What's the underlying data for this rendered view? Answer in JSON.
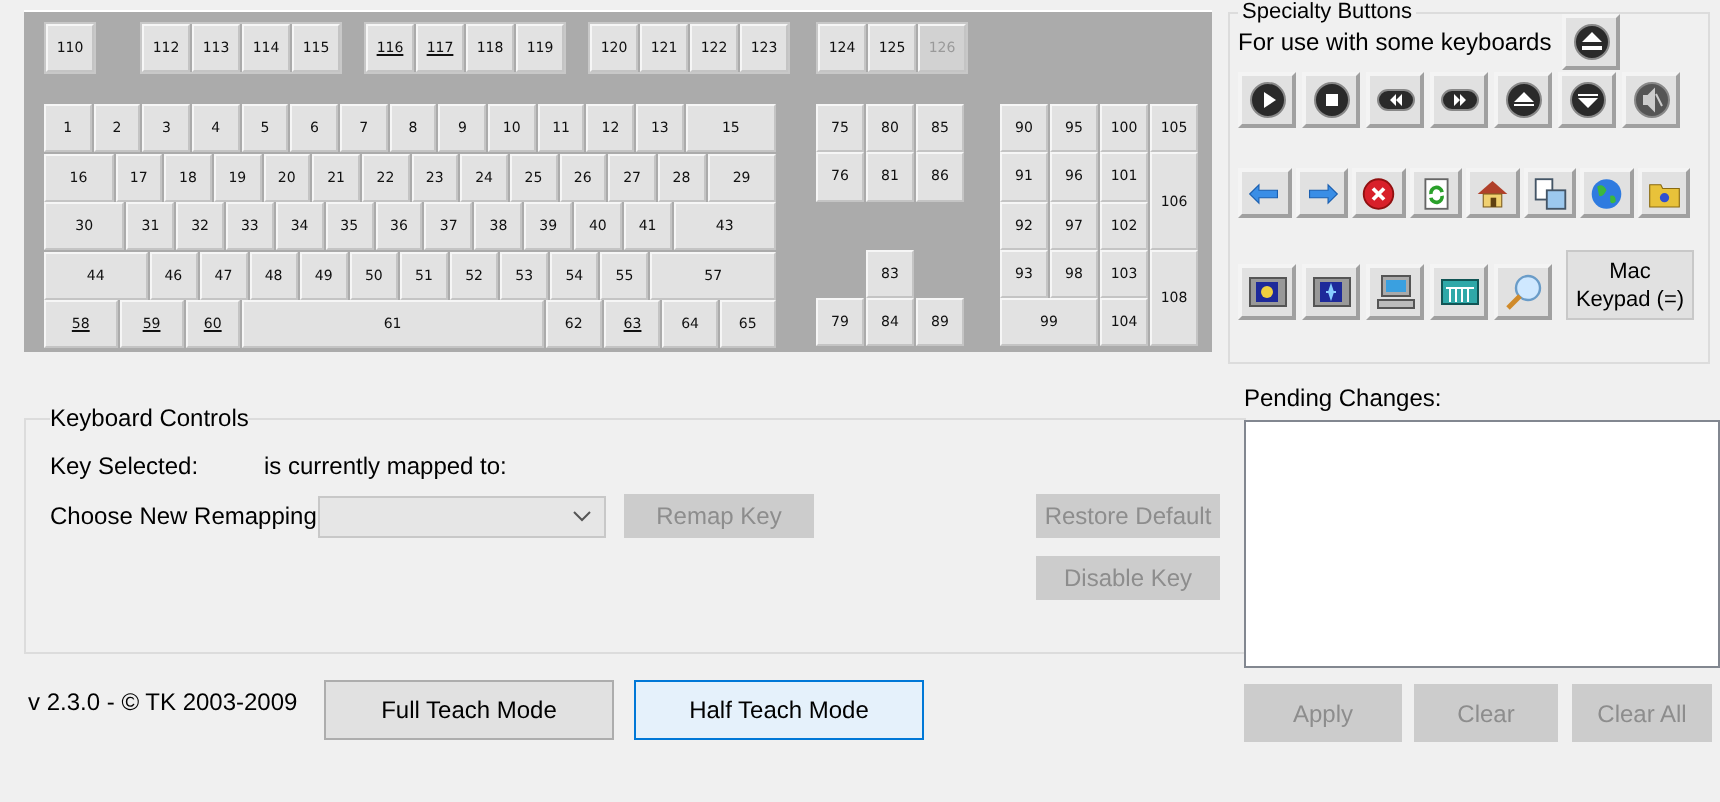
{
  "keyboard": {
    "function_groups": [
      [
        {
          "label": "110",
          "underlined": false
        }
      ],
      [
        {
          "label": "112",
          "underlined": false
        },
        {
          "label": "113",
          "underlined": false
        },
        {
          "label": "114",
          "underlined": false
        },
        {
          "label": "115",
          "underlined": false
        }
      ],
      [
        {
          "label": "116",
          "underlined": true
        },
        {
          "label": "117",
          "underlined": true
        },
        {
          "label": "118",
          "underlined": false
        },
        {
          "label": "119",
          "underlined": false
        }
      ],
      [
        {
          "label": "120",
          "underlined": false
        },
        {
          "label": "121",
          "underlined": false
        },
        {
          "label": "122",
          "underlined": false
        },
        {
          "label": "123",
          "underlined": false
        }
      ]
    ],
    "main_rows": [
      [
        {
          "label": "1",
          "underlined": false
        },
        {
          "label": "2",
          "underlined": false
        },
        {
          "label": "3",
          "underlined": false
        },
        {
          "label": "4",
          "underlined": false
        },
        {
          "label": "5",
          "underlined": false
        },
        {
          "label": "6",
          "underlined": false
        },
        {
          "label": "7",
          "underlined": false
        },
        {
          "label": "8",
          "underlined": false
        },
        {
          "label": "9",
          "underlined": false
        },
        {
          "label": "10",
          "underlined": false
        },
        {
          "label": "11",
          "underlined": false
        },
        {
          "label": "12",
          "underlined": false
        },
        {
          "label": "13",
          "underlined": false
        },
        {
          "label": "15",
          "underlined": false
        }
      ],
      [
        {
          "label": "16",
          "underlined": false
        },
        {
          "label": "17",
          "underlined": false
        },
        {
          "label": "18",
          "underlined": false
        },
        {
          "label": "19",
          "underlined": false
        },
        {
          "label": "20",
          "underlined": false
        },
        {
          "label": "21",
          "underlined": false
        },
        {
          "label": "22",
          "underlined": false
        },
        {
          "label": "23",
          "underlined": false
        },
        {
          "label": "24",
          "underlined": false
        },
        {
          "label": "25",
          "underlined": false
        },
        {
          "label": "26",
          "underlined": false
        },
        {
          "label": "27",
          "underlined": false
        },
        {
          "label": "28",
          "underlined": false
        },
        {
          "label": "29",
          "underlined": false
        }
      ],
      [
        {
          "label": "30",
          "underlined": false
        },
        {
          "label": "31",
          "underlined": false
        },
        {
          "label": "32",
          "underlined": false
        },
        {
          "label": "33",
          "underlined": false
        },
        {
          "label": "34",
          "underlined": false
        },
        {
          "label": "35",
          "underlined": false
        },
        {
          "label": "36",
          "underlined": false
        },
        {
          "label": "37",
          "underlined": false
        },
        {
          "label": "38",
          "underlined": false
        },
        {
          "label": "39",
          "underlined": false
        },
        {
          "label": "40",
          "underlined": false
        },
        {
          "label": "41",
          "underlined": false
        },
        {
          "label": "43",
          "underlined": false
        }
      ],
      [
        {
          "label": "44",
          "underlined": false
        },
        {
          "label": "46",
          "underlined": false
        },
        {
          "label": "47",
          "underlined": false
        },
        {
          "label": "48",
          "underlined": false
        },
        {
          "label": "49",
          "underlined": false
        },
        {
          "label": "50",
          "underlined": false
        },
        {
          "label": "51",
          "underlined": false
        },
        {
          "label": "52",
          "underlined": false
        },
        {
          "label": "53",
          "underlined": false
        },
        {
          "label": "54",
          "underlined": false
        },
        {
          "label": "55",
          "underlined": false
        },
        {
          "label": "57",
          "underlined": false
        }
      ],
      [
        {
          "label": "58",
          "underlined": true
        },
        {
          "label": "59",
          "underlined": true
        },
        {
          "label": "60",
          "underlined": true
        },
        {
          "label": "61",
          "underlined": false
        },
        {
          "label": "62",
          "underlined": false
        },
        {
          "label": "63",
          "underlined": true
        },
        {
          "label": "64",
          "underlined": false
        },
        {
          "label": "65",
          "underlined": false
        }
      ]
    ],
    "extra_keys": [
      {
        "label": "124",
        "disabled": false
      },
      {
        "label": "125",
        "disabled": false
      },
      {
        "label": "126",
        "disabled": true
      }
    ],
    "nav_keys": [
      {
        "label": "75"
      },
      {
        "label": "80"
      },
      {
        "label": "85"
      },
      {
        "label": "76"
      },
      {
        "label": "81"
      },
      {
        "label": "86"
      },
      {
        "label": "83"
      },
      {
        "label": "79"
      },
      {
        "label": "84"
      },
      {
        "label": "89"
      }
    ],
    "numpad_keys": [
      {
        "label": "90"
      },
      {
        "label": "95"
      },
      {
        "label": "100"
      },
      {
        "label": "105"
      },
      {
        "label": "91"
      },
      {
        "label": "96"
      },
      {
        "label": "101"
      },
      {
        "label": "106"
      },
      {
        "label": "92"
      },
      {
        "label": "97"
      },
      {
        "label": "102"
      },
      {
        "label": "93"
      },
      {
        "label": "98"
      },
      {
        "label": "103"
      },
      {
        "label": "108"
      },
      {
        "label": "99"
      },
      {
        "label": "104"
      }
    ]
  },
  "specialty": {
    "title": "Specialty Buttons",
    "note": "For use with some keyboards",
    "rows": [
      [
        {
          "kind": "eject"
        }
      ],
      [
        {
          "kind": "play"
        },
        {
          "kind": "stop"
        },
        {
          "kind": "rewind"
        },
        {
          "kind": "forward"
        },
        {
          "kind": "up"
        },
        {
          "kind": "down"
        },
        {
          "kind": "mute"
        }
      ],
      [
        {
          "kind": "back"
        },
        {
          "kind": "next"
        },
        {
          "kind": "cancel"
        },
        {
          "kind": "refresh"
        },
        {
          "kind": "home"
        },
        {
          "kind": "copy"
        },
        {
          "kind": "globe"
        },
        {
          "kind": "folder"
        }
      ],
      [
        {
          "kind": "sleep"
        },
        {
          "kind": "wake"
        },
        {
          "kind": "computer"
        },
        {
          "kind": "keypad"
        },
        {
          "kind": "search"
        },
        {
          "kind": "text",
          "label": "Mac Keypad (=)"
        }
      ]
    ]
  },
  "controls": {
    "title": "Keyboard Controls",
    "key_selected_label": "Key Selected:",
    "mapped_label": "is currently mapped to:",
    "remap_label": "Choose New Remapping",
    "remap_select": {
      "disabled": true
    },
    "buttons": [
      {
        "label": "Remap Key",
        "disabled": true
      },
      {
        "label": "Restore Default",
        "disabled": true
      },
      {
        "label": "Disable Key",
        "disabled": true
      }
    ]
  },
  "version": "v 2.3.0 - © TK 2003-2009",
  "teach_modes": [
    {
      "label": "Full Teach Mode",
      "selected": false
    },
    {
      "label": "Half Teach Mode",
      "selected": true
    }
  ],
  "pending": {
    "label": "Pending Changes:",
    "buttons": [
      {
        "label": "Apply",
        "disabled": true
      },
      {
        "label": "Clear",
        "disabled": true
      },
      {
        "label": "Clear All",
        "disabled": true
      }
    ]
  }
}
